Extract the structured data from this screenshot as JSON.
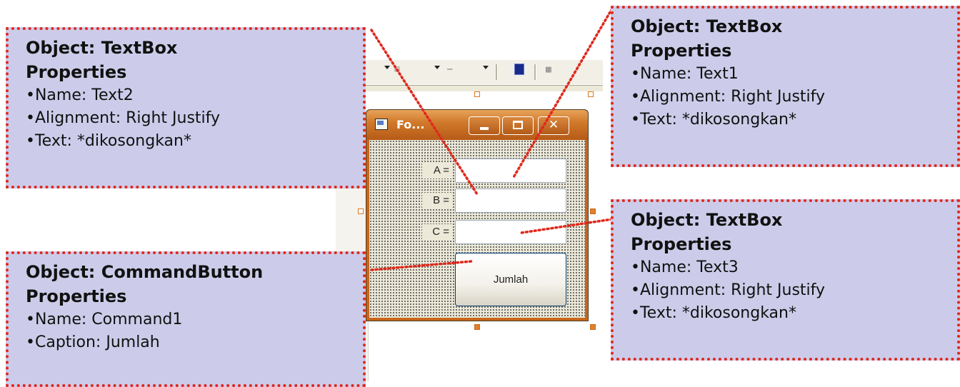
{
  "form": {
    "title": "Fo...",
    "minimize_glyph": "",
    "maximize_glyph": "",
    "close_glyph": "✕",
    "labels": [
      "A =",
      "B =",
      "C ="
    ],
    "button_caption": "Jumlah"
  },
  "callouts": {
    "text2": {
      "title": "Object: TextBox",
      "subtitle": "Properties",
      "lines": [
        "•Name: Text2",
        "•Alignment: Right Justify",
        "•Text: *dikosongkan*"
      ]
    },
    "text1": {
      "title": "Object: TextBox",
      "subtitle": "Properties",
      "lines": [
        "•Name: Text1",
        "•Alignment: Right Justify",
        "•Text: *dikosongkan*"
      ]
    },
    "command1": {
      "title": "Object: CommandButton",
      "subtitle": "Properties",
      "lines": [
        "•Name: Command1",
        "•Caption: Jumlah"
      ]
    },
    "text3": {
      "title": "Object: TextBox",
      "subtitle": "Properties",
      "lines": [
        "•Name: Text3",
        "•Alignment: Right Justify",
        "•Text: *dikosongkan*"
      ]
    }
  },
  "colors": {
    "callout_fill": "#ccccea",
    "callout_border": "#e0281c",
    "titlebar": "#c9651b"
  },
  "icons": [
    "form-window-icon",
    "minimize-icon",
    "maximize-icon",
    "close-icon"
  ]
}
